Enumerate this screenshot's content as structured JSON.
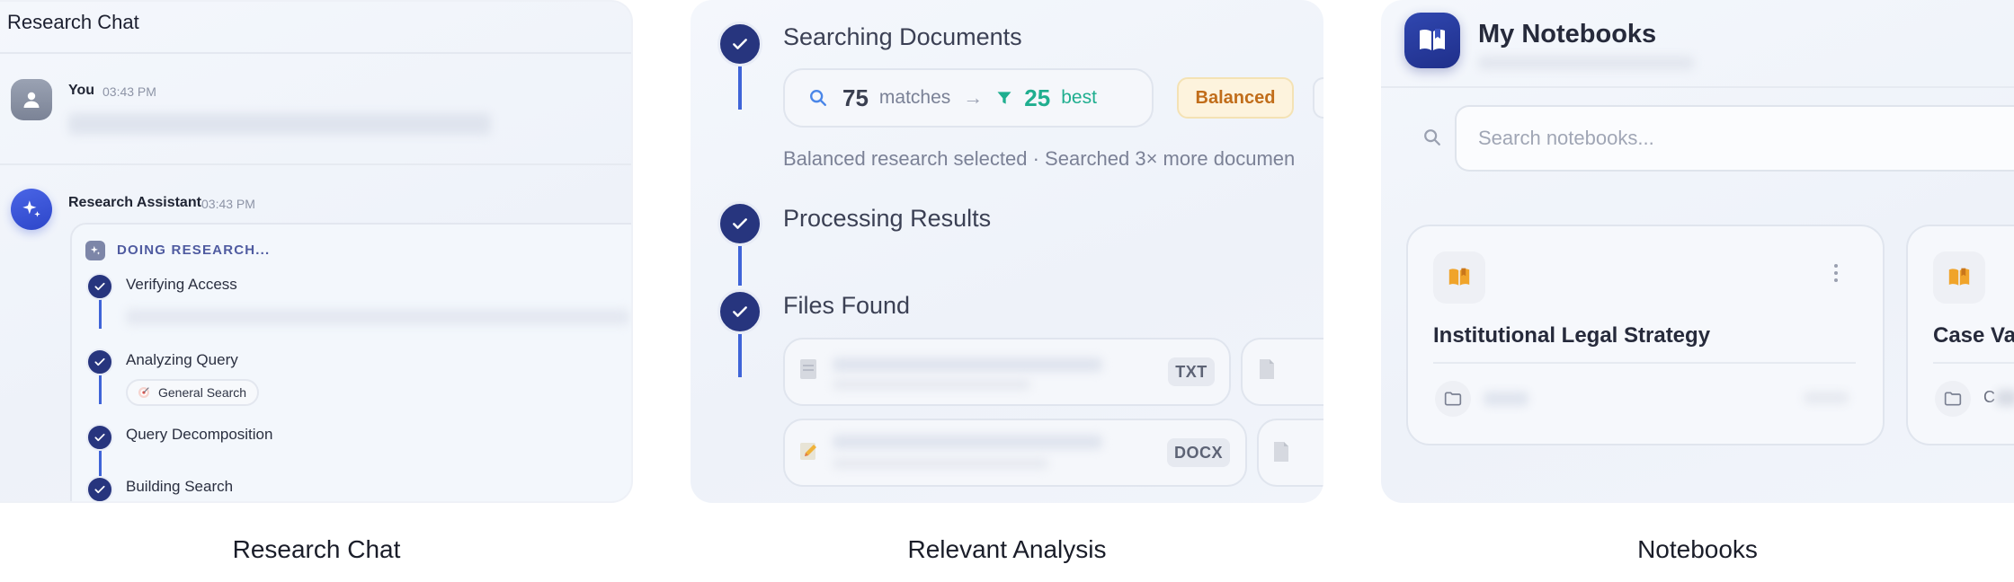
{
  "captions": {
    "research_chat": "Research Chat",
    "relevant_analysis": "Relevant Analysis",
    "notebooks": "Notebooks"
  },
  "chat": {
    "title": "Research Chat",
    "user_message": {
      "sender": "You",
      "time": "03:43 PM"
    },
    "assistant_message": {
      "sender": "Research Assistant",
      "time": "03:43 PM"
    },
    "research_status": "DOING RESEARCH...",
    "steps": [
      {
        "label": "Verifying Access"
      },
      {
        "label": "Analyzing Query",
        "chip": "General Search",
        "chip_icon": "target-icon"
      },
      {
        "label": "Query Decomposition"
      },
      {
        "label": "Building Search"
      }
    ]
  },
  "analysis": {
    "steps": [
      {
        "label": "Searching Documents"
      },
      {
        "label": "Processing Results"
      },
      {
        "label": "Files Found"
      }
    ],
    "matches_count": "75",
    "matches_label": "matches",
    "arrow": "→",
    "best_count": "25",
    "best_label": "best",
    "mode_badge": "Balanced",
    "summary": "Balanced research selected · Searched 3× more documen",
    "files": [
      {
        "type": "TXT",
        "icon": "document-icon"
      },
      {
        "type": "DOCX",
        "icon": "edit-document-icon"
      }
    ]
  },
  "notebooks": {
    "title": "My Notebooks",
    "search_placeholder": "Search notebooks...",
    "cards": [
      {
        "title": "Institutional Legal Strategy"
      },
      {
        "title": "Case Va",
        "footer_text": "C"
      }
    ]
  },
  "colors": {
    "accent_navy": "#27357e",
    "accent_blue": "#3f64d8",
    "best_green": "#1fae8f",
    "balanced_orange": "#c16d1a",
    "notebook_icon": "#f0a42a"
  }
}
